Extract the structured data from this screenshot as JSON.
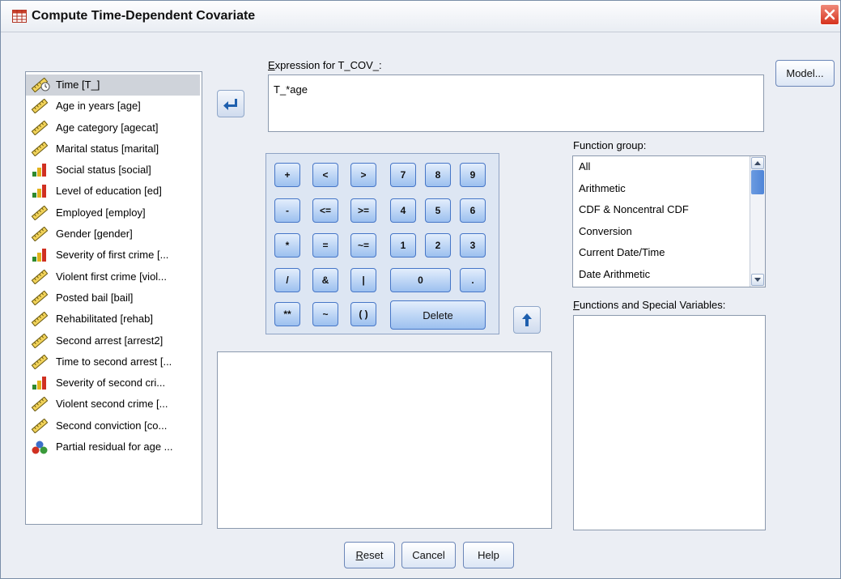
{
  "window": {
    "title": "Compute Time-Dependent Covariate",
    "close_icon": "close-icon"
  },
  "variables": [
    {
      "label": "Time [T_]",
      "icon": "time-ruler-icon",
      "selected": true
    },
    {
      "label": "Age in years [age]",
      "icon": "scale-ruler-icon"
    },
    {
      "label": "Age category [agecat]",
      "icon": "scale-ruler-icon"
    },
    {
      "label": "Marital status [marital]",
      "icon": "scale-ruler-icon"
    },
    {
      "label": "Social status [social]",
      "icon": "ordinal-bars-icon"
    },
    {
      "label": "Level of education [ed]",
      "icon": "ordinal-bars-icon"
    },
    {
      "label": "Employed [employ]",
      "icon": "scale-ruler-icon"
    },
    {
      "label": "Gender [gender]",
      "icon": "scale-ruler-icon"
    },
    {
      "label": "Severity of first crime [...",
      "icon": "ordinal-bars-icon"
    },
    {
      "label": "Violent first crime [viol...",
      "icon": "scale-ruler-icon"
    },
    {
      "label": "Posted bail [bail]",
      "icon": "scale-ruler-icon"
    },
    {
      "label": "Rehabilitated [rehab]",
      "icon": "scale-ruler-icon"
    },
    {
      "label": "Second arrest [arrest2]",
      "icon": "scale-ruler-icon"
    },
    {
      "label": "Time to second arrest [...",
      "icon": "scale-ruler-icon"
    },
    {
      "label": "Severity of second cri...",
      "icon": "ordinal-bars-icon"
    },
    {
      "label": "Violent second crime [...",
      "icon": "scale-ruler-icon"
    },
    {
      "label": "Second conviction [co...",
      "icon": "scale-ruler-icon"
    },
    {
      "label": "Partial residual for age ...",
      "icon": "nominal-balls-icon"
    }
  ],
  "expression": {
    "label_prefix": "E",
    "label_rest": "xpression for T_COV_:",
    "value": "T_*age"
  },
  "keypad": {
    "plus": "+",
    "lt": "<",
    "gt": ">",
    "k7": "7",
    "k8": "8",
    "k9": "9",
    "minus": "-",
    "le": "<=",
    "ge": ">=",
    "k4": "4",
    "k5": "5",
    "k6": "6",
    "times": "*",
    "eq": "=",
    "ne": "~=",
    "k1": "1",
    "k2": "2",
    "k3": "3",
    "divide": "/",
    "and": "&",
    "or": "|",
    "k0": "0",
    "dot": ".",
    "power": "**",
    "not": "~",
    "parens": "( )",
    "delete": "Delete"
  },
  "function_group": {
    "label_pre": "Function ",
    "label_u": "g",
    "label_post": "roup:",
    "items": [
      "All",
      "Arithmetic",
      "CDF & Noncentral CDF",
      "Conversion",
      "Current Date/Time",
      "Date Arithmetic"
    ]
  },
  "functions": {
    "label_u": "F",
    "label_rest": "unctions and Special Variables:"
  },
  "buttons": {
    "model": "Model...",
    "reset_u": "R",
    "reset_rest": "eset",
    "cancel": "Cancel",
    "help": "Help"
  },
  "colors": {
    "keypad_blue": "#9cc0ef",
    "selection": "#cfd3da",
    "close_red": "#d6321d"
  }
}
